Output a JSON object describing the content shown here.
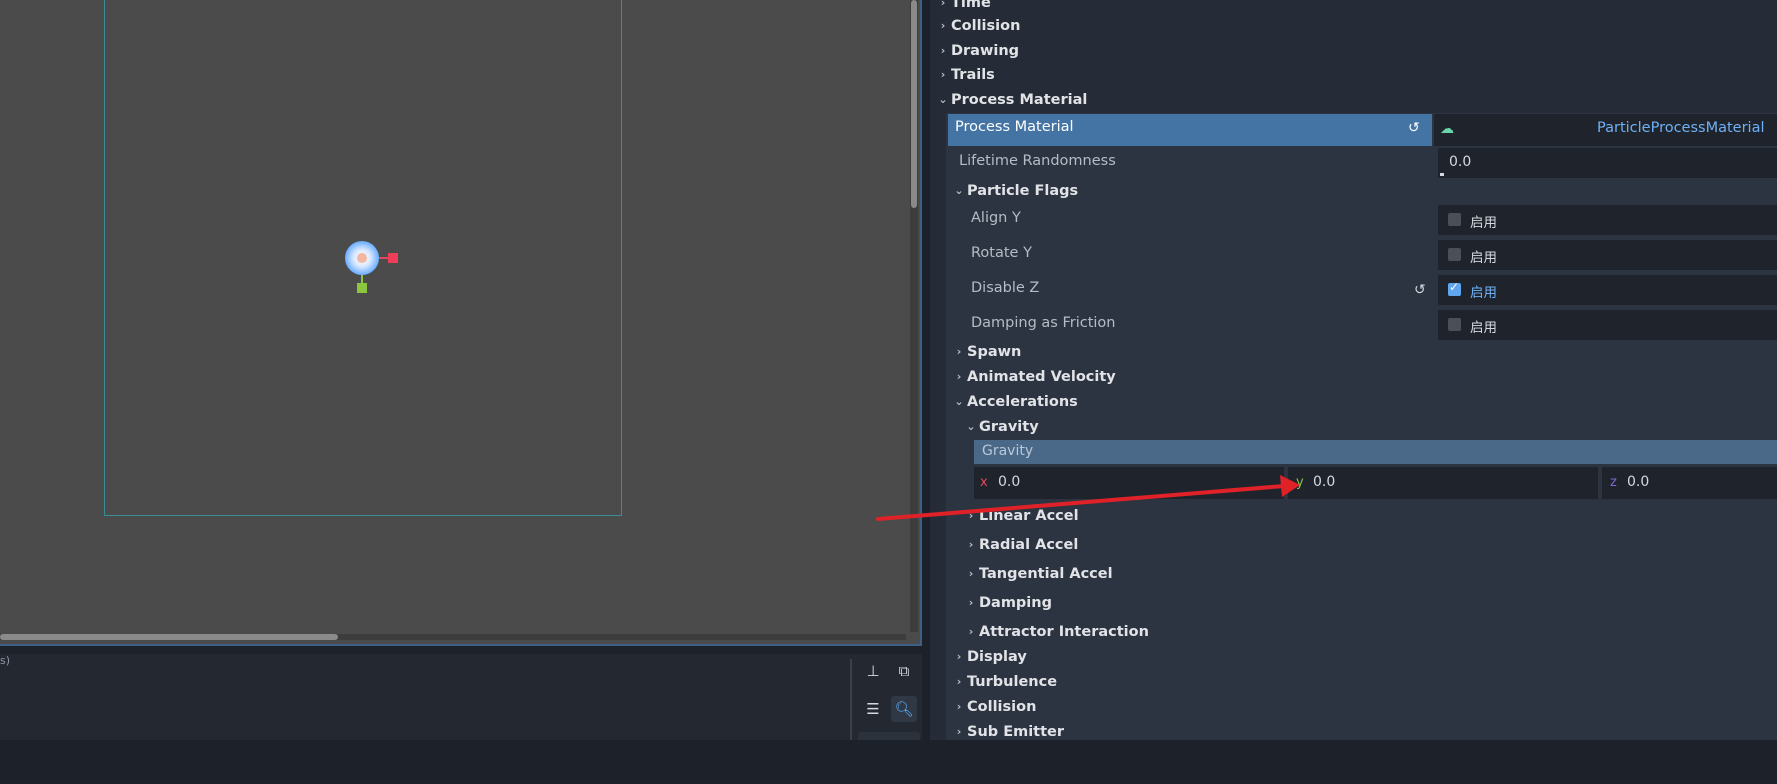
{
  "output": {
    "text": "s)"
  },
  "inspector": {
    "top_categories": [
      {
        "label": "Time",
        "open": false
      },
      {
        "label": "Collision",
        "open": false
      },
      {
        "label": "Drawing",
        "open": false
      },
      {
        "label": "Trails",
        "open": false
      },
      {
        "label": "Process Material",
        "open": true
      }
    ],
    "process_material": {
      "label": "Process Material",
      "value": "ParticleProcessMaterial",
      "lifetime_randomness": {
        "label": "Lifetime Randomness",
        "value": "0.0"
      },
      "particle_flags": {
        "label": "Particle Flags",
        "items": [
          {
            "label": "Align Y",
            "checked": false,
            "text": "启用"
          },
          {
            "label": "Rotate Y",
            "checked": false,
            "text": "启用"
          },
          {
            "label": "Disable Z",
            "checked": true,
            "text": "启用"
          },
          {
            "label": "Damping as Friction",
            "checked": false,
            "text": "启用"
          }
        ]
      },
      "spawn": "Spawn",
      "animated_velocity": "Animated Velocity",
      "accelerations": {
        "label": "Accelerations",
        "gravity": {
          "label": "Gravity",
          "bar_label": "Gravity",
          "x": "0.0",
          "y": "0.0",
          "z": "0.0",
          "axis_x": "x",
          "axis_y": "y",
          "axis_z": "z"
        },
        "sub": [
          "Linear Accel",
          "Radial Accel",
          "Tangential Accel",
          "Damping",
          "Attractor Interaction"
        ]
      },
      "bottom": [
        "Display",
        "Turbulence",
        "Collision",
        "Sub Emitter"
      ]
    }
  },
  "colors": {
    "accent": "#4374a4",
    "axis_x": "#e0485c",
    "axis_y": "#8cc63f",
    "axis_z": "#7a6ad8",
    "annotation": "#e02228"
  }
}
